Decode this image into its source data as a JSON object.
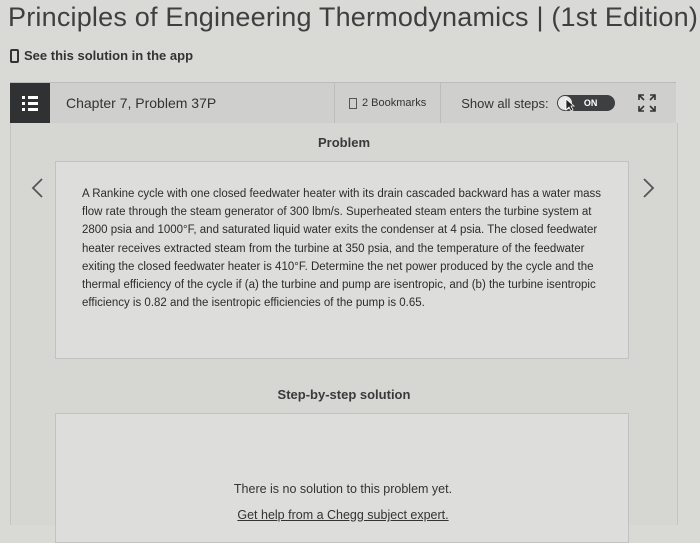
{
  "book": {
    "title": "Principles of Engineering Thermodynamics | (1st Edition)"
  },
  "app_link": {
    "label": "See this solution in the app",
    "icon": "phone-icon"
  },
  "toolbar": {
    "menu_icon": "list-icon",
    "chapter_label": "Chapter 7, Problem 37P",
    "bookmarks_label": "2 Bookmarks",
    "show_steps_label": "Show all steps:",
    "toggle_label": "ON",
    "expand_icon": "expand-icon"
  },
  "problem": {
    "heading": "Problem",
    "text": "A Rankine cycle with one closed feedwater heater with its drain cascaded backward has a water mass flow rate through the steam generator of 300 lbm/s. Superheated steam enters the turbine system at 2800 psia and 1000°F, and saturated liquid water exits the condenser at 4 psia. The closed feedwater heater receives extracted steam from the turbine at 350 psia, and the temperature of the feedwater exiting the closed feedwater heater is 410°F. Determine the net power produced by the cycle and the thermal efficiency of the cycle if (a) the turbine and pump are isentropic, and (b) the turbine isentropic efficiency is 0.82 and the isentropic efficiencies of the pump is 0.65."
  },
  "solution": {
    "heading": "Step-by-step solution",
    "empty_message": "There is no solution to this problem yet.",
    "help_link": "Get help from a Chegg subject expert."
  }
}
